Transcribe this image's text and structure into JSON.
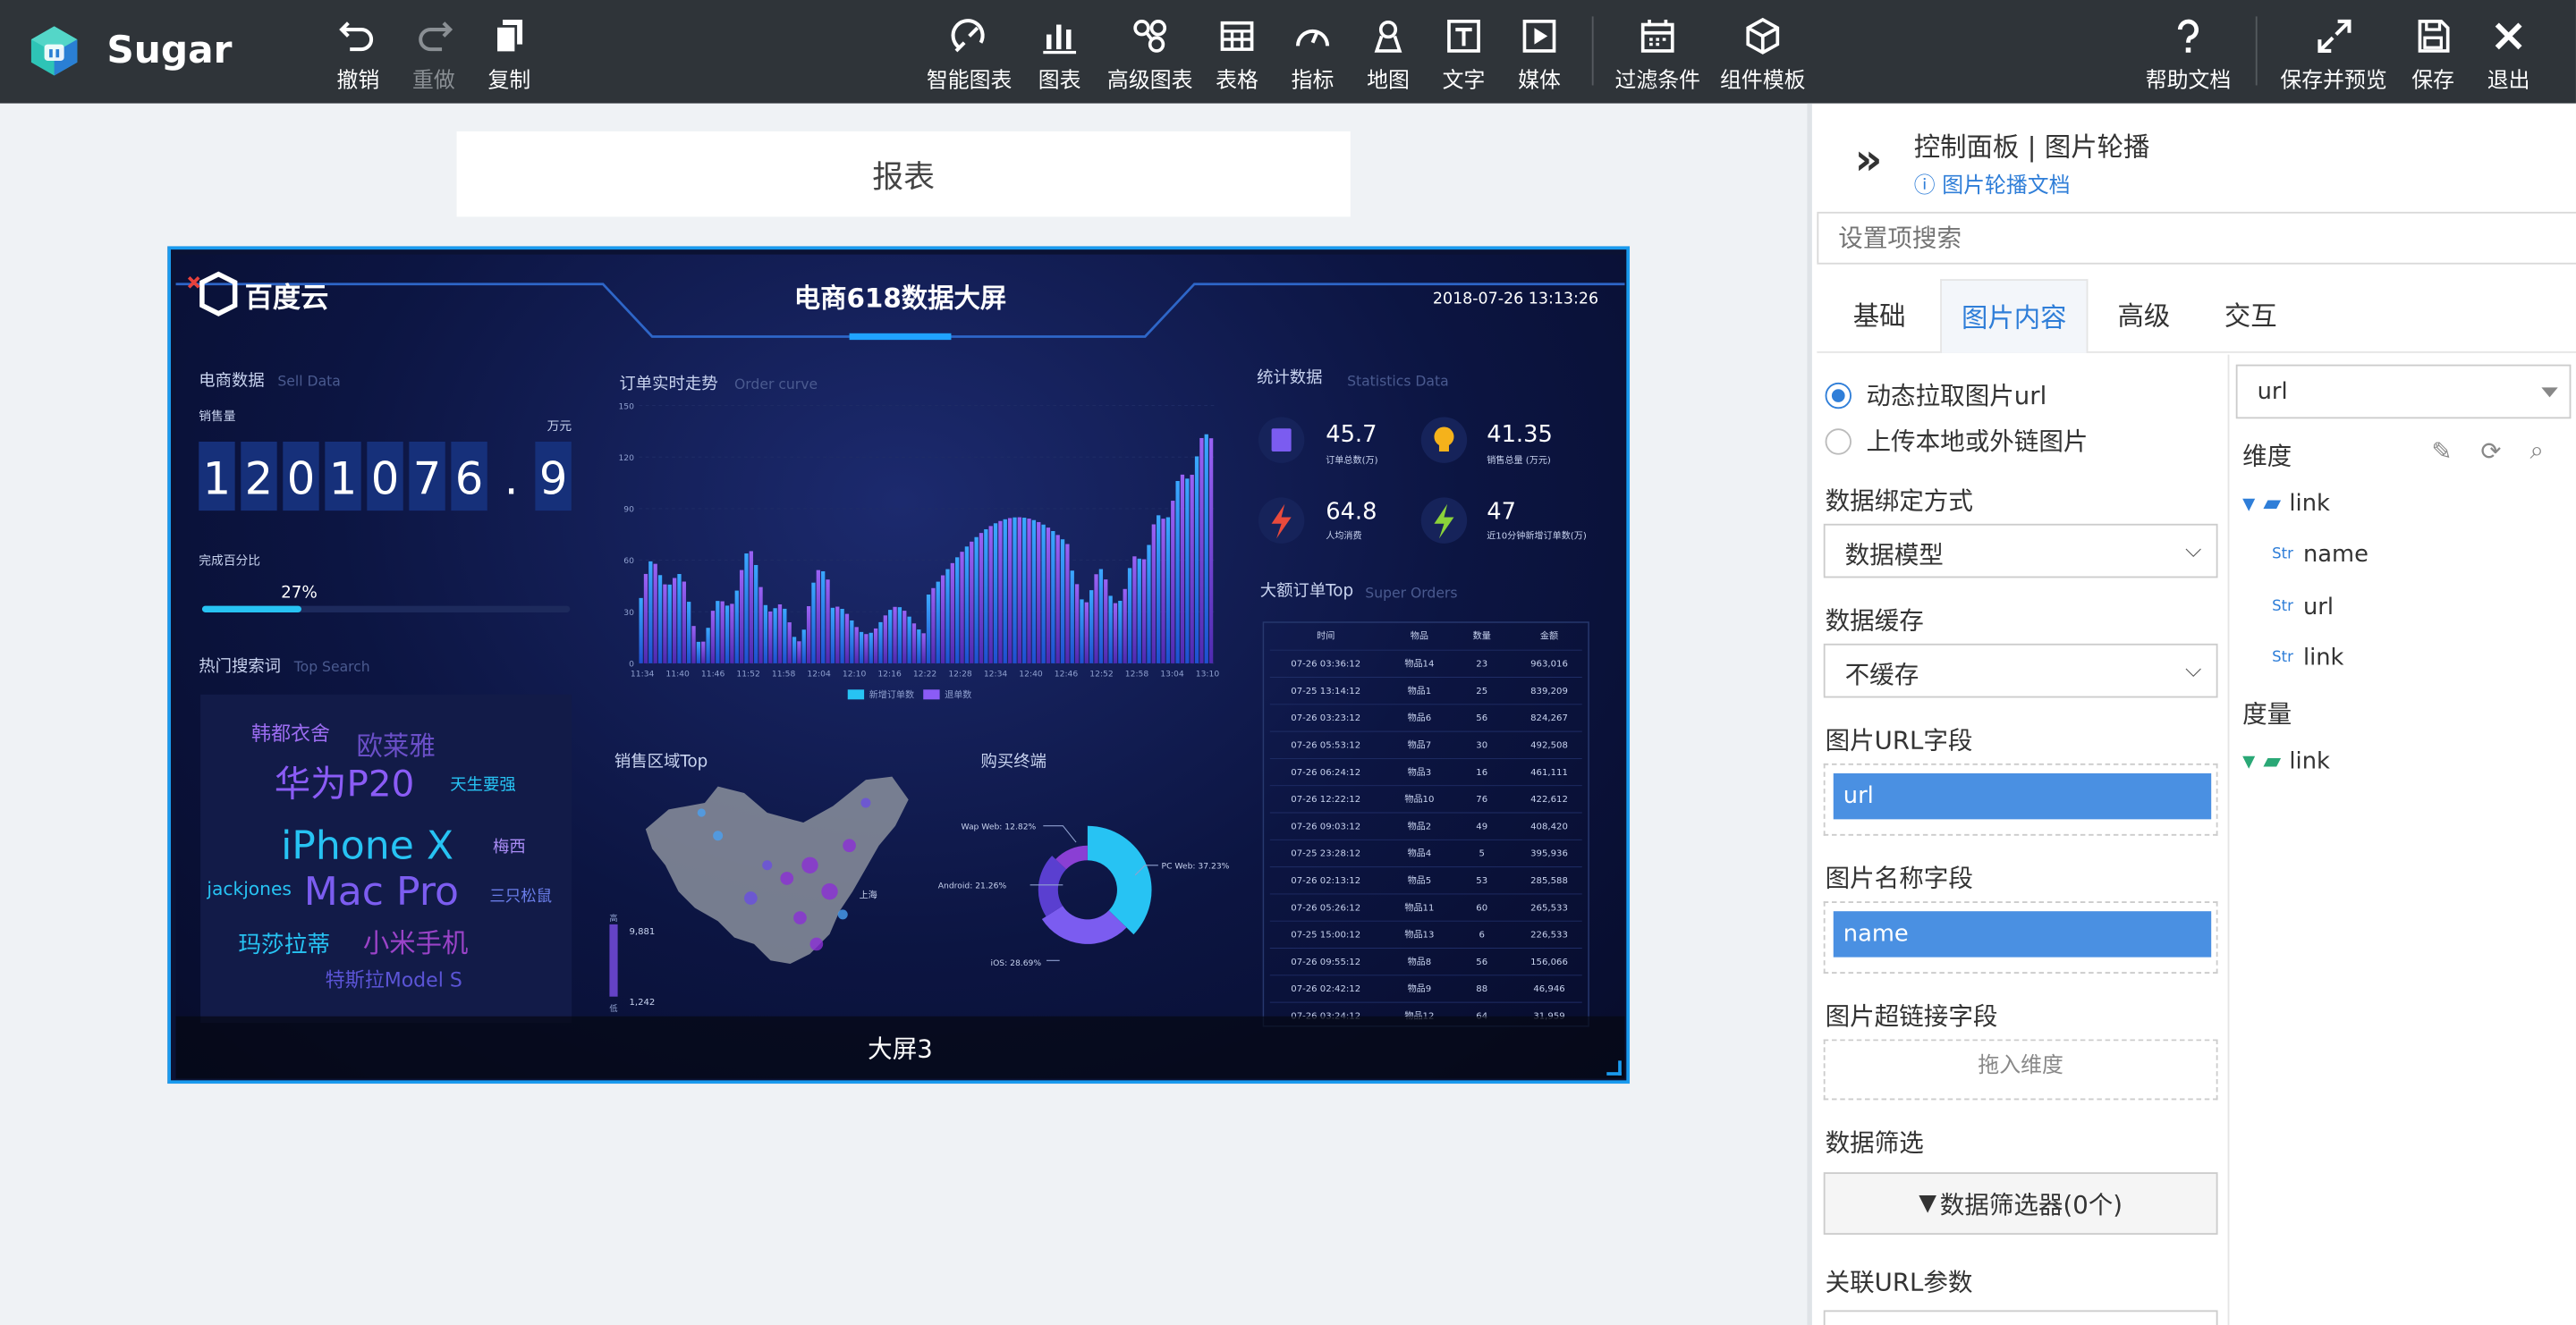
{
  "app": {
    "name": "Sugar"
  },
  "toolbar": {
    "undo": "撤销",
    "redo": "重做",
    "copy": "复制",
    "smart_chart": "智能图表",
    "chart": "图表",
    "advanced_chart": "高级图表",
    "table": "表格",
    "indicator": "指标",
    "map": "地图",
    "text": "文字",
    "media": "媒体",
    "filter": "过滤条件",
    "component_template": "组件模板",
    "help": "帮助文档",
    "save_preview": "保存并预览",
    "save": "保存",
    "exit": "退出"
  },
  "canvas": {
    "report_title": "报表",
    "carousel_caption": "大屏3"
  },
  "screen": {
    "logo": "百度云",
    "title": "电商618数据大屏",
    "datetime": "2018-07-26 13:13:26",
    "sell_title": "电商数据",
    "sell_sub": "Sell Data",
    "sales_label": "销售量",
    "sales_unit": "万元",
    "sales_digits": [
      "1",
      "2",
      "0",
      "1",
      "0",
      "7",
      "6",
      ".",
      "9"
    ],
    "percent_label": "完成百分比",
    "percent": "27%",
    "percent_value": 0.27,
    "search_title": "热门搜索词",
    "search_sub": "Top Search",
    "words": [
      {
        "t": "韩都衣舍",
        "c": "#9b6cf0"
      },
      {
        "t": "欧莱雅",
        "c": "#6a4fc8"
      },
      {
        "t": "华为P20",
        "c": "#8b5cf6"
      },
      {
        "t": "天生要强",
        "c": "#27c3f3"
      },
      {
        "t": "iPhone X",
        "c": "#27c3f3"
      },
      {
        "t": "梅西",
        "c": "#a98cf5"
      },
      {
        "t": "jackjones",
        "c": "#27c3f3"
      },
      {
        "t": "Mac Pro",
        "c": "#7c5df0"
      },
      {
        "t": "三只松鼠",
        "c": "#6a7de8"
      },
      {
        "t": "玛莎拉蒂",
        "c": "#27c3f3"
      },
      {
        "t": "小米手机",
        "c": "#9a43c8"
      },
      {
        "t": "特斯拉Model S",
        "c": "#5b54d6"
      }
    ],
    "order_title": "订单实时走势",
    "order_sub": "Order curve",
    "order_yticks": [
      "150",
      "120",
      "90",
      "60",
      "30",
      "0"
    ],
    "order_xticks": [
      "11:34",
      "11:40",
      "11:46",
      "11:52",
      "11:58",
      "12:04",
      "12:10",
      "12:16",
      "12:22",
      "12:28",
      "12:34",
      "12:40",
      "12:46",
      "12:52",
      "12:58",
      "13:04",
      "13:10"
    ],
    "legend_new": "新增订单数",
    "legend_return": "退单数",
    "region_title": "销售区域Top",
    "region_high": "9,881",
    "region_low": "1,242",
    "region_city": "上海",
    "region_scale_high": "高",
    "region_scale_low": "低",
    "terminal_title": "购买终端",
    "terminal": [
      {
        "name": "PC Web",
        "value": 37.23,
        "label": "PC Web: 37.23%"
      },
      {
        "name": "iOS",
        "value": 28.69,
        "label": "iOS: 28.69%"
      },
      {
        "name": "Android",
        "value": 21.26,
        "label": "Android: 21.26%"
      },
      {
        "name": "Wap Web",
        "value": 12.82,
        "label": "Wap Web: 12.82%"
      }
    ],
    "stats_title": "统计数据",
    "stats_sub": "Statistics Data",
    "stats": [
      {
        "value": "45.7",
        "label": "订单总数(万)",
        "icon": "clipboard-icon",
        "color": "#7b5cf0"
      },
      {
        "value": "41.35",
        "label": "销售总量 (万元)",
        "icon": "bulb-icon",
        "color": "#f5b21b"
      },
      {
        "value": "64.8",
        "label": "人均消费",
        "icon": "bolt-icon",
        "color": "#e84a3c"
      },
      {
        "value": "47",
        "label": "近10分钟新增订单数(万)",
        "icon": "bolt-icon",
        "color": "#8bd23a"
      }
    ],
    "top_title": "大额订单Top",
    "top_sub": "Super Orders",
    "top_headers": [
      "时间",
      "物品",
      "数量",
      "金额"
    ],
    "top_rows": [
      [
        "07-26 03:36:12",
        "物品14",
        "23",
        "963,016"
      ],
      [
        "07-25 13:14:12",
        "物品1",
        "25",
        "839,209"
      ],
      [
        "07-26 03:23:12",
        "物品6",
        "56",
        "824,267"
      ],
      [
        "07-26 05:53:12",
        "物品7",
        "30",
        "492,508"
      ],
      [
        "07-26 06:24:12",
        "物品3",
        "16",
        "461,111"
      ],
      [
        "07-26 12:22:12",
        "物品10",
        "76",
        "422,612"
      ],
      [
        "07-26 09:03:12",
        "物品2",
        "49",
        "408,420"
      ],
      [
        "07-25 23:28:12",
        "物品4",
        "5",
        "395,936"
      ],
      [
        "07-26 02:13:12",
        "物品5",
        "53",
        "285,588"
      ],
      [
        "07-26 05:26:12",
        "物品11",
        "60",
        "265,533"
      ],
      [
        "07-25 15:00:12",
        "物品13",
        "6",
        "226,533"
      ],
      [
        "07-26 09:55:12",
        "物品8",
        "56",
        "156,066"
      ],
      [
        "07-26 02:42:12",
        "物品9",
        "88",
        "46,946"
      ],
      [
        "07-26 03:24:12",
        "物品12",
        "64",
        "31,959"
      ]
    ]
  },
  "panel": {
    "title": "控制面板 | 图片轮播",
    "doc_link": "图片轮播文档",
    "search_placeholder": "设置项搜索",
    "tabs": [
      "基础",
      "图片内容",
      "高级",
      "交互"
    ],
    "radio_dynamic": "动态拉取图片url",
    "radio_upload": "上传本地或外链图片",
    "bind_label": "数据绑定方式",
    "bind_value": "数据模型",
    "cache_label": "数据缓存",
    "cache_value": "不缓存",
    "url_field_label": "图片URL字段",
    "url_field_value": "url",
    "name_field_label": "图片名称字段",
    "name_field_value": "name",
    "link_field_label": "图片超链接字段",
    "link_field_placeholder": "拖入维度",
    "filter_label": "数据筛选",
    "filter_button": "数据筛选器(0个)",
    "url_param_label": "关联URL参数",
    "model_select": "url",
    "dim_label": "维度",
    "dim_folder": "link",
    "dim_fields": [
      {
        "type": "Str",
        "name": "name"
      },
      {
        "type": "Str",
        "name": "url"
      },
      {
        "type": "Str",
        "name": "link"
      }
    ],
    "measure_label": "度量",
    "measure_folder": "link"
  }
}
